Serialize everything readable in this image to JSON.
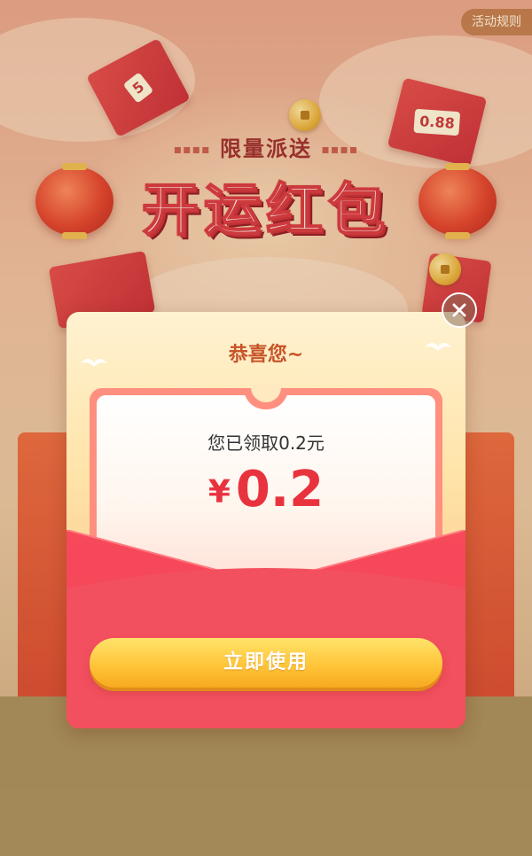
{
  "header": {
    "rules_label": "活动规则",
    "subtitle": "限量派送",
    "title": "开运红包"
  },
  "decorations": {
    "envelope_tag_left": "5",
    "envelope_tag_right": "0.88"
  },
  "modal": {
    "congrats": "恭喜您~",
    "received_text": "您已领取0.2元",
    "currency_symbol": "¥",
    "amount": "0.2",
    "use_button": "立即使用",
    "close_icon": "close-icon"
  },
  "colors": {
    "accent_red": "#e8333f",
    "button_yellow": "#ffc53a",
    "title_orange": "#c7552a"
  }
}
